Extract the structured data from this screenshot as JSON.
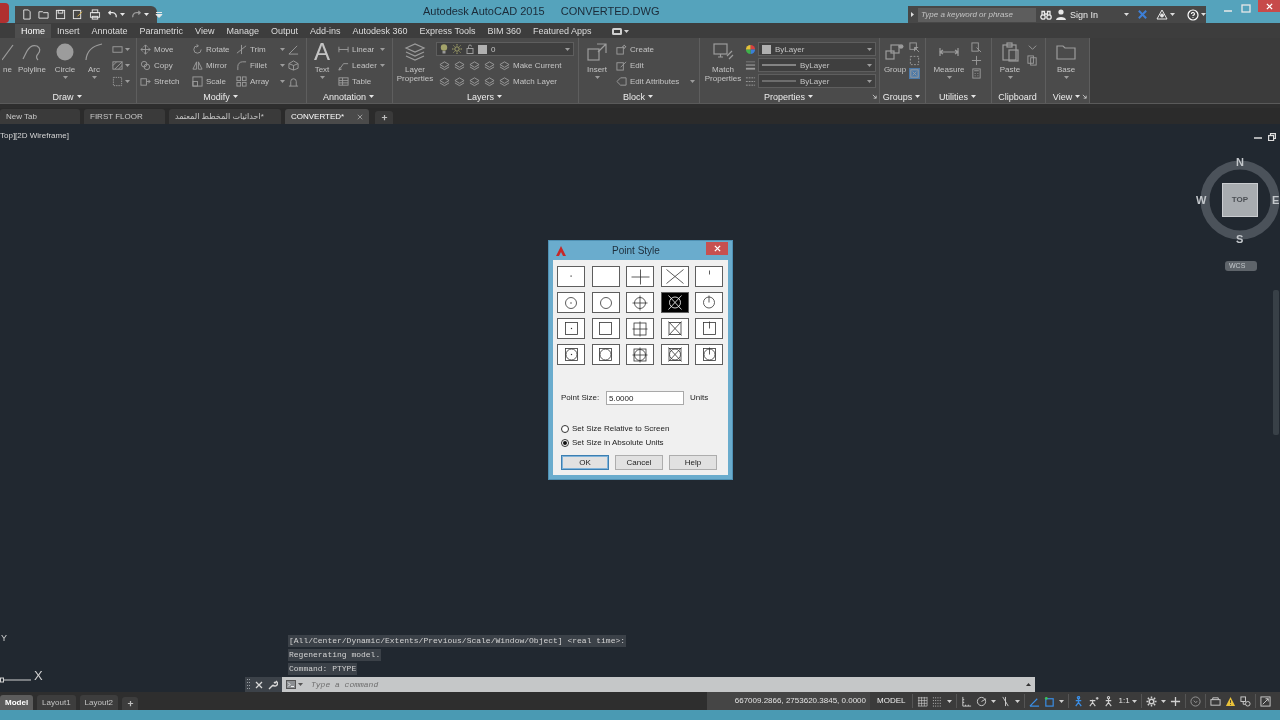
{
  "title_bar": {
    "app_title": "Autodesk AutoCAD 2015",
    "file_title": "CONVERTED.DWG",
    "search": {
      "placeholder": "Type a keyword or phrase"
    },
    "sign_in": "Sign In"
  },
  "ribbon_tabs": [
    {
      "label": "Home",
      "selected": true
    },
    {
      "label": "Insert",
      "selected": false
    },
    {
      "label": "Annotate",
      "selected": false
    },
    {
      "label": "Parametric",
      "selected": false
    },
    {
      "label": "View",
      "selected": false
    },
    {
      "label": "Manage",
      "selected": false
    },
    {
      "label": "Output",
      "selected": false
    },
    {
      "label": "Add-ins",
      "selected": false
    },
    {
      "label": "Autodesk 360",
      "selected": false
    },
    {
      "label": "Express Tools",
      "selected": false
    },
    {
      "label": "BIM 360",
      "selected": false
    },
    {
      "label": "Featured Apps",
      "selected": false
    }
  ],
  "ribbon": {
    "disabled": true,
    "panels": [
      {
        "kind": "draw",
        "title": "Draw",
        "menu": true,
        "launcher": false,
        "tools": [
          {
            "label": "ne",
            "menu": false
          },
          {
            "label": "Polyline",
            "menu": false
          },
          {
            "label": "Circle",
            "menu": true
          },
          {
            "label": "Arc",
            "menu": true
          }
        ]
      },
      {
        "kind": "modify",
        "title": "Modify",
        "menu": true,
        "launcher": false,
        "tools": [
          {
            "label": "Move",
            "menu": false
          },
          {
            "label": "Rotate",
            "menu": false
          },
          {
            "label": "Trim",
            "menu": true
          },
          {
            "label": "Copy",
            "menu": false
          },
          {
            "label": "Mirror",
            "menu": false
          },
          {
            "label": "Fillet",
            "menu": true
          },
          {
            "label": "Stretch",
            "menu": false
          },
          {
            "label": "Scale",
            "menu": false
          },
          {
            "label": "Array",
            "menu": true
          }
        ]
      },
      {
        "kind": "annotation",
        "title": "Annotation",
        "menu": true,
        "launcher": false,
        "tools": [
          {
            "label": "Text",
            "glyph": "A",
            "menu": true
          },
          {
            "label": "Linear",
            "menu": true
          },
          {
            "label": "Leader",
            "menu": true
          },
          {
            "label": "Table",
            "menu": false
          }
        ]
      },
      {
        "kind": "layers",
        "title": "Layers",
        "menu": true,
        "launcher": false,
        "tools": [
          {
            "label": "Layer Properties",
            "menu": false
          },
          {
            "label": "Make Current",
            "menu": false
          },
          {
            "label": "Match Layer",
            "menu": false
          }
        ],
        "layer": {
          "value": "0"
        }
      },
      {
        "kind": "block",
        "title": "Block",
        "menu": true,
        "launcher": false,
        "tools": [
          {
            "label": "Insert",
            "menu": true
          },
          {
            "label": "Create",
            "menu": false
          },
          {
            "label": "Edit",
            "menu": false
          },
          {
            "label": "Edit Attributes",
            "menu": true
          }
        ]
      },
      {
        "kind": "properties",
        "title": "Properties",
        "menu": true,
        "launcher": true,
        "tools": [
          {
            "label": "Match Properties",
            "menu": false
          }
        ],
        "dropdowns": [
          {
            "kind": "color",
            "value": "ByLayer"
          },
          {
            "kind": "lineweight",
            "value": "ByLayer"
          },
          {
            "kind": "linetype",
            "value": "ByLayer"
          }
        ]
      },
      {
        "kind": "groups",
        "title": "Groups",
        "menu": true,
        "launcher": false,
        "tools": [
          {
            "label": "Group",
            "menu": false
          }
        ],
        "toggles": [
          {
            "on": false
          },
          {
            "on": false
          },
          {
            "on": true
          }
        ]
      },
      {
        "kind": "utilities",
        "title": "Utilities",
        "menu": true,
        "launcher": false,
        "tools": [
          {
            "label": "Measure",
            "menu": true
          }
        ]
      },
      {
        "kind": "clipboard",
        "title": "Clipboard",
        "menu": false,
        "launcher": false,
        "tools": [
          {
            "label": "Paste",
            "menu": true
          }
        ]
      },
      {
        "kind": "view",
        "title": "View",
        "menu": true,
        "launcher": true,
        "tools": [
          {
            "label": "Base",
            "menu": true
          }
        ]
      }
    ]
  },
  "file_tabs": [
    {
      "label": "New Tab",
      "selected": false
    },
    {
      "label": "FIRST FLOOR",
      "selected": false
    },
    {
      "label": "احداثيات المخطط المعتمد*",
      "selected": false
    },
    {
      "label": "CONVERTED*",
      "selected": true
    }
  ],
  "viewport": {
    "label": "Top][2D Wireframe]",
    "view_cube": {
      "face": "TOP",
      "north": "N",
      "south": "S",
      "west": "W",
      "east": "E"
    },
    "coordinate_system": "WCS",
    "ucs": {
      "x": "X",
      "y": "Y"
    }
  },
  "dialog": {
    "title": "Point Style",
    "point_style_rows": [
      {
        "kind": "plain",
        "cells": [
          {
            "kind": "dot",
            "selected": false
          },
          {
            "kind": "none",
            "selected": false
          },
          {
            "kind": "plus",
            "selected": false
          },
          {
            "kind": "cross",
            "selected": false
          },
          {
            "kind": "bar",
            "selected": false
          }
        ]
      },
      {
        "kind": "circle",
        "cells": [
          {
            "kind": "dot",
            "selected": false
          },
          {
            "kind": "none",
            "selected": false
          },
          {
            "kind": "plus",
            "selected": false
          },
          {
            "kind": "cross",
            "selected": true
          },
          {
            "kind": "bar",
            "selected": false
          }
        ]
      },
      {
        "kind": "square",
        "cells": [
          {
            "kind": "dot",
            "selected": false
          },
          {
            "kind": "none",
            "selected": false
          },
          {
            "kind": "plus",
            "selected": false
          },
          {
            "kind": "cross",
            "selected": false
          },
          {
            "kind": "bar",
            "selected": false
          }
        ]
      },
      {
        "kind": "squarecircle",
        "cells": [
          {
            "kind": "dot",
            "selected": false
          },
          {
            "kind": "none",
            "selected": false
          },
          {
            "kind": "plus",
            "selected": false
          },
          {
            "kind": "cross",
            "selected": false
          },
          {
            "kind": "bar",
            "selected": false
          }
        ]
      }
    ],
    "point_size": {
      "label": "Point Size:",
      "value": "5.0000",
      "unit": "Units"
    },
    "size_modes": [
      {
        "label": "Set Size Relative to Screen",
        "selected": false
      },
      {
        "label": "Set Size in Absolute Units",
        "selected": true
      }
    ],
    "buttons": [
      {
        "label": "OK",
        "default": true
      },
      {
        "label": "Cancel",
        "default": false
      },
      {
        "label": "Help",
        "default": false
      }
    ]
  },
  "command_history": [
    "[All/Center/Dynamic/Extents/Previous/Scale/Window/Object] <real time>:",
    "Regenerating model.",
    "Command: PTYPE"
  ],
  "command_line": {
    "placeholder": "Type a command"
  },
  "layout_tabs": [
    {
      "label": "Model",
      "selected": true
    },
    {
      "label": "Layout1",
      "selected": false
    },
    {
      "label": "Layout2",
      "selected": false
    }
  ],
  "status_bar": {
    "coordinates": "667009.2866, 2753620.3845, 0.0000",
    "space": "MODEL",
    "annotation_scale": "1:1",
    "toggles": [
      {
        "on": false
      },
      {
        "on": false
      },
      {
        "on": false
      },
      {
        "on": false
      },
      {
        "on": false
      },
      {
        "on": true
      },
      {
        "on": true
      },
      {
        "on": true
      },
      {
        "on": false
      },
      {
        "on": false
      }
    ]
  }
}
